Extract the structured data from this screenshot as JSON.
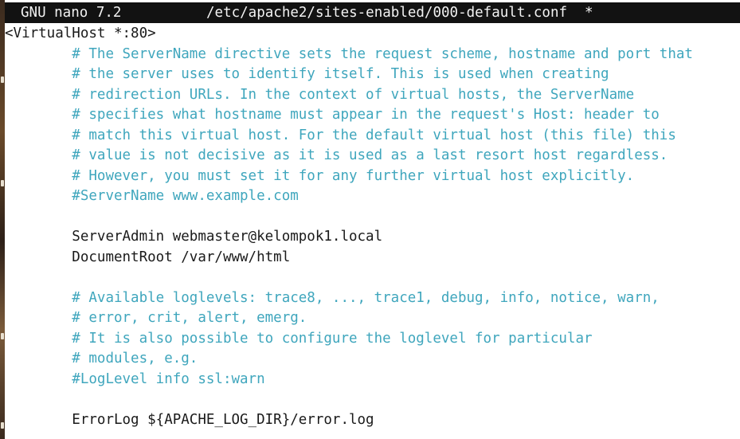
{
  "titlebar": {
    "app_name": "GNU nano 7.2",
    "file_path": "/etc/apache2/sites-enabled/000-default.conf",
    "modified_marker": "*"
  },
  "editor": {
    "lines": [
      {
        "indent": "",
        "text": "<VirtualHost *:80>",
        "kind": "code"
      },
      {
        "indent": "        ",
        "text": "# The ServerName directive sets the request scheme, hostname and port that",
        "kind": "comment"
      },
      {
        "indent": "        ",
        "text": "# the server uses to identify itself. This is used when creating",
        "kind": "comment"
      },
      {
        "indent": "        ",
        "text": "# redirection URLs. In the context of virtual hosts, the ServerName",
        "kind": "comment"
      },
      {
        "indent": "        ",
        "text": "# specifies what hostname must appear in the request's Host: header to",
        "kind": "comment"
      },
      {
        "indent": "        ",
        "text": "# match this virtual host. For the default virtual host (this file) this",
        "kind": "comment"
      },
      {
        "indent": "        ",
        "text": "# value is not decisive as it is used as a last resort host regardless.",
        "kind": "comment"
      },
      {
        "indent": "        ",
        "text": "# However, you must set it for any further virtual host explicitly.",
        "kind": "comment"
      },
      {
        "indent": "        ",
        "text": "#ServerName www.example.com",
        "kind": "comment"
      },
      {
        "indent": "",
        "text": "",
        "kind": "code"
      },
      {
        "indent": "        ",
        "text": "ServerAdmin webmaster@kelompok1.local",
        "kind": "code"
      },
      {
        "indent": "        ",
        "text": "DocumentRoot /var/www/html",
        "kind": "code"
      },
      {
        "indent": "",
        "text": "",
        "kind": "code"
      },
      {
        "indent": "        ",
        "text": "# Available loglevels: trace8, ..., trace1, debug, info, notice, warn,",
        "kind": "comment"
      },
      {
        "indent": "        ",
        "text": "# error, crit, alert, emerg.",
        "kind": "comment"
      },
      {
        "indent": "        ",
        "text": "# It is also possible to configure the loglevel for particular",
        "kind": "comment"
      },
      {
        "indent": "        ",
        "text": "# modules, e.g.",
        "kind": "comment"
      },
      {
        "indent": "        ",
        "text": "#LogLevel info ssl:warn",
        "kind": "comment"
      },
      {
        "indent": "",
        "text": "",
        "kind": "code"
      },
      {
        "indent": "        ",
        "text": "ErrorLog ${APACHE_LOG_DIR}/error.log",
        "kind": "code"
      }
    ]
  }
}
